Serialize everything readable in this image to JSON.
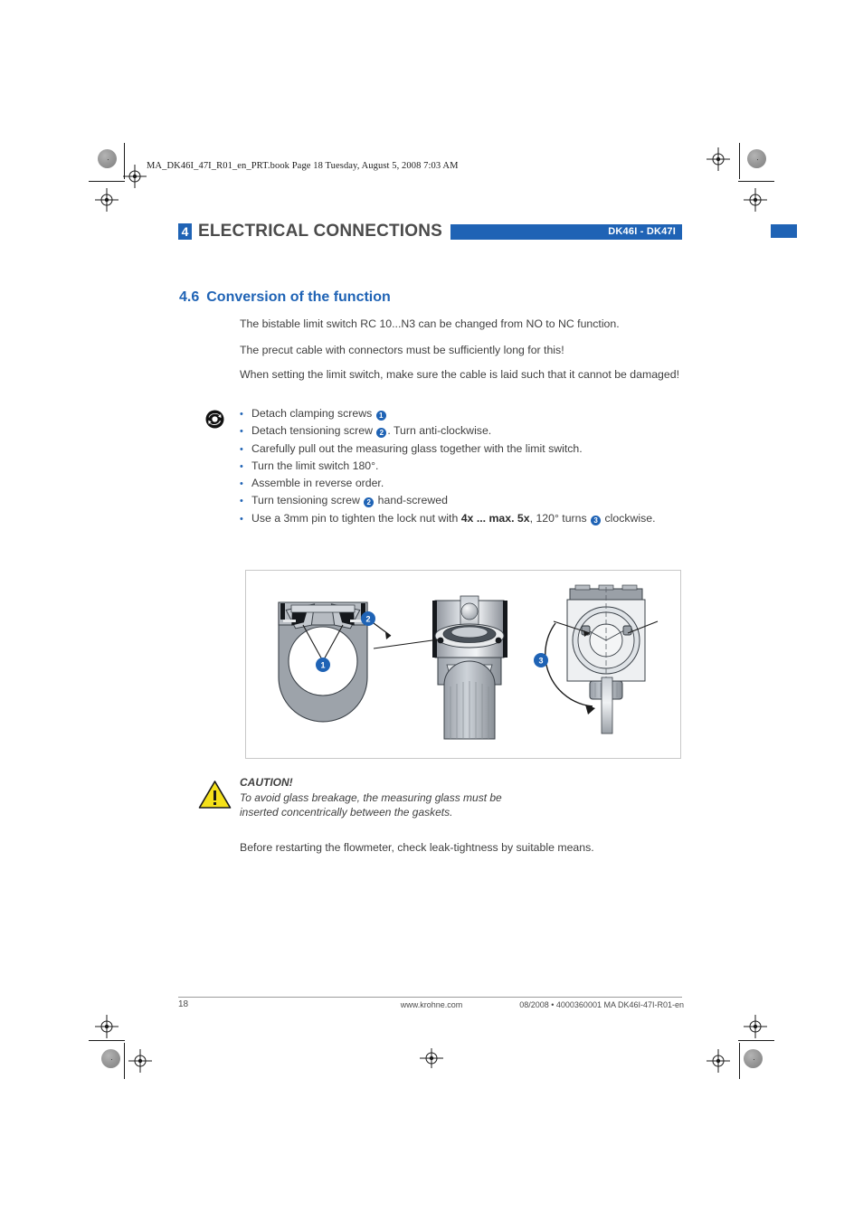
{
  "print_header": {
    "text": "MA_DK46I_47I_R01_en_PRT.book  Page 18  Tuesday, August 5, 2008  7:03 AM"
  },
  "chapter": {
    "number": "4",
    "title": "ELECTRICAL CONNECTIONS",
    "product_range": "DK46I - DK47I"
  },
  "section": {
    "number": "4.6",
    "title": "Conversion of the function",
    "paragraphs": [
      "The bistable limit switch RC 10...N3 can be changed from NO to NC function.",
      "The precut cable with connectors must be sufficiently long for this!",
      "When setting the limit switch, make sure the cable is laid such that it cannot be damaged!"
    ],
    "closing_paragraph": "Before restarting the flowmeter, check leak-tightness by suitable means."
  },
  "instructions": {
    "icon": "hand-action-icon",
    "bullet_glyph": "•",
    "steps": [
      {
        "pre": "Detach clamping screws ",
        "badge": "1",
        "post": ""
      },
      {
        "pre": "Detach tensioning screw ",
        "badge": "2",
        "post": ". Turn anti-clockwise."
      },
      {
        "pre": "Carefully pull out the measuring glass together with the limit switch.",
        "badge": "",
        "post": ""
      },
      {
        "pre": "Turn the limit switch 180°.",
        "badge": "",
        "post": ""
      },
      {
        "pre": "Assemble in reverse order.",
        "badge": "",
        "post": ""
      },
      {
        "pre": "Turn tensioning screw ",
        "badge": "2",
        "post": " hand-screwed"
      },
      {
        "pre": "Use a 3mm pin to tighten the lock nut with ",
        "bold": "4x ... max. 5x",
        "mid": ",  120° turns ",
        "badge": "3",
        "post": " clockwise."
      }
    ]
  },
  "figure": {
    "callouts": [
      "1",
      "2",
      "3"
    ],
    "panels": [
      {
        "name": "clamping-screws-view",
        "callout": "1"
      },
      {
        "name": "tensioning-screw-view",
        "callout": "2"
      },
      {
        "name": "lock-nut-rotation-view",
        "callout": "3"
      }
    ]
  },
  "caution": {
    "icon": "warning-triangle-icon",
    "title": "CAUTION!",
    "line1": "To avoid glass breakage, the measuring glass must be",
    "line2": "inserted concentrically between the gaskets."
  },
  "footer": {
    "page_number": "18",
    "website": "www.krohne.com",
    "document_code": "08/2008 • 4000360001   MA DK46I-47I-R01-en"
  },
  "colors": {
    "accent_blue": "#1f63b5",
    "heading_gray": "#4b4b4b",
    "body_gray": "#3f3f3f",
    "caution_yellow": "#f5e11a"
  }
}
